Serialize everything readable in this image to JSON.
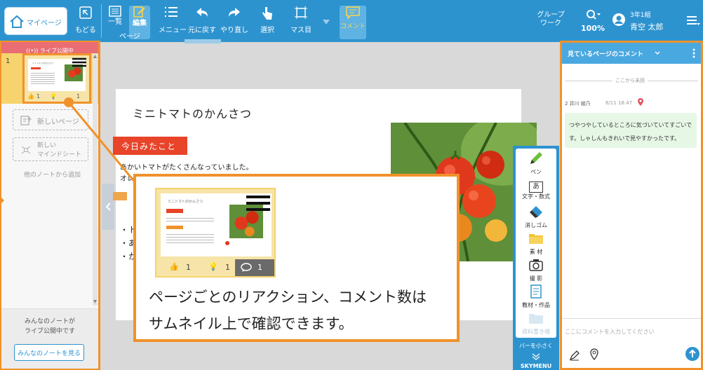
{
  "toolbar": {
    "mypage": "マイページ",
    "back": "もどる",
    "list": "一覧",
    "edit": "編集",
    "page": "ページ",
    "menu": "メニュー",
    "undo": "元に戻す",
    "redo": "やり直し",
    "select": "選択",
    "masu": "マス目",
    "comment": "コメント",
    "group_work_1": "グループ",
    "group_work_2": "ワーク",
    "zoom": "100%",
    "user_class": "3年1組",
    "user_name": "青空 太郎"
  },
  "sidebar": {
    "live_banner": "((•)) ライブ公開中",
    "page_number": "1",
    "thumb_title": "ミニトマトのかんさつ",
    "thumb_likes": "1",
    "thumb_ideas": "1",
    "thumb_comments": "1",
    "new_page": "新しいページ",
    "new_mindmap_1": "新しい",
    "new_mindmap_2": "マインドシート",
    "add_from_other": "他のノートから追加",
    "everyone_live_1": "みんなのノートが",
    "everyone_live_2": "ライブ公開中です",
    "see_everyone_button": "みんなのノートを見る"
  },
  "page": {
    "title": "ミニトマトのかんさつ",
    "section_label": "今日みたこと",
    "body_line1": "あかいトマトがたくさんなっていました。",
    "body_line2": "オレ",
    "bullets": [
      "・ト",
      "・あ",
      "・か"
    ]
  },
  "tools": {
    "pen": "ペン",
    "text": "文字・数式",
    "text_glyph": "あ",
    "eraser": "消しゴム",
    "material": "素 材",
    "photo": "撮 影",
    "teaching": "教材・作品",
    "storage": "資料置き場",
    "bar_small_1": "バーを小さく",
    "skymenu": "SKYMENU"
  },
  "comments": {
    "header": "見ているページのコメント",
    "unread_divider": "ここから未読",
    "entry_author": "2 井川 綾乃",
    "entry_time": "6/11 18:47",
    "entry_text": "つやつやしているところに気づいていてすごいです。しゃしんもきれいで見やすかったです。",
    "input_placeholder": "ここにコメントを入力してください"
  },
  "callout": {
    "line1": "ページごとのリアクション、コメント数は",
    "line2": "サムネイル上で確認できます。",
    "likes": "1",
    "ideas": "1",
    "comments": "1"
  },
  "colors": {
    "toolbar": "#2d93cf",
    "accent_orange": "#f0922b",
    "section_red": "#e8442a",
    "comment_header": "#4aa8e0",
    "comment_bubble": "#e6f7e6"
  }
}
